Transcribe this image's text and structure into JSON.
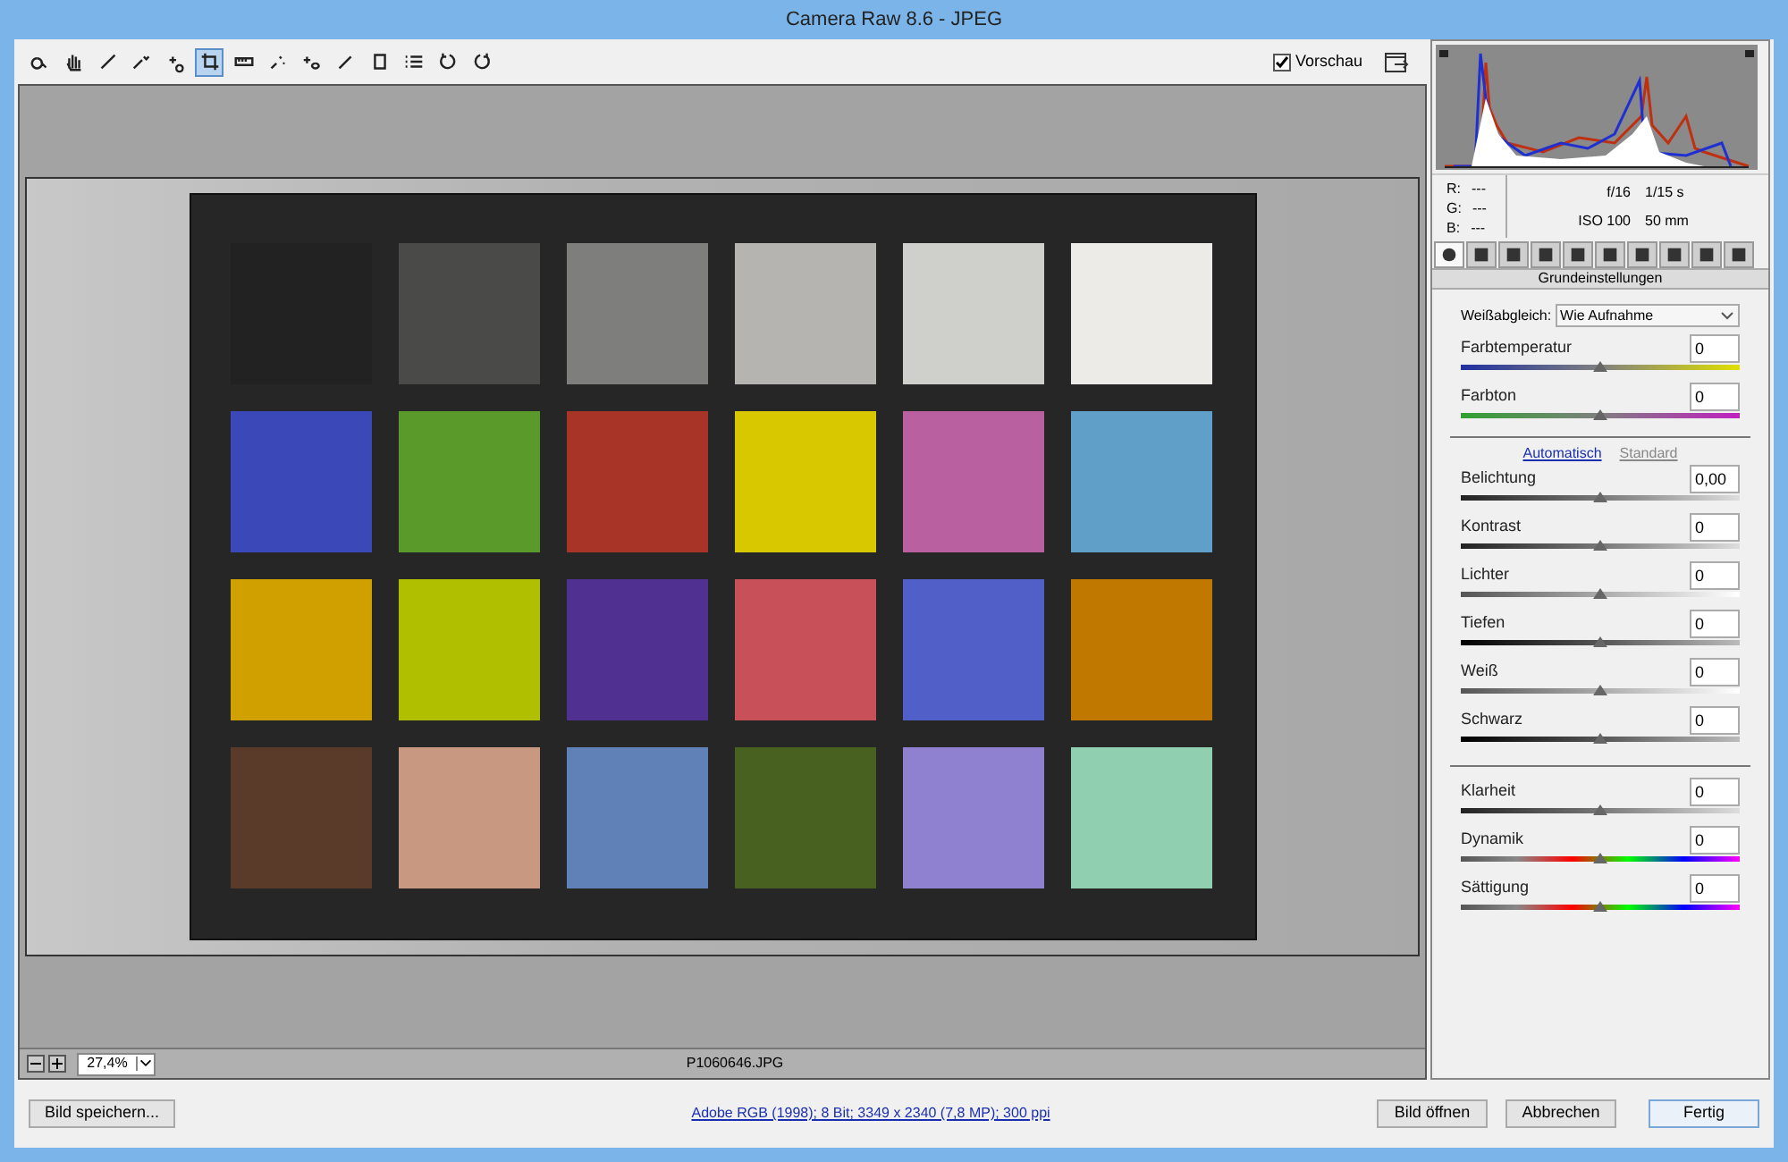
{
  "window": {
    "title": "Camera Raw 8.6 - JPEG"
  },
  "toolbar": {
    "tools": [
      {
        "selected": false
      },
      {
        "selected": false
      },
      {
        "selected": false
      },
      {
        "selected": false
      },
      {
        "selected": false
      },
      {
        "selected": true
      },
      {
        "selected": false
      },
      {
        "selected": false
      },
      {
        "selected": false
      },
      {
        "selected": false
      },
      {
        "selected": false
      },
      {
        "selected": false
      },
      {
        "selected": false
      },
      {
        "selected": false
      }
    ],
    "preview": {
      "label": "Vorschau",
      "checked": true
    }
  },
  "canvas": {
    "zoom": "27,4%",
    "filename": "P1060646.JPG"
  },
  "info": {
    "r_label": "R:",
    "r": "---",
    "g_label": "G:",
    "g": "---",
    "b_label": "B:",
    "b": "---",
    "aperture": "f/16",
    "shutter": "1/15 s",
    "iso": "ISO 100",
    "focal": "50 mm"
  },
  "panel_tabs": [
    {
      "selected": true
    },
    {
      "selected": false
    },
    {
      "selected": false
    },
    {
      "selected": false
    },
    {
      "selected": false
    },
    {
      "selected": false
    },
    {
      "selected": false
    },
    {
      "selected": false
    },
    {
      "selected": false
    },
    {
      "selected": false
    }
  ],
  "panel_title": "Grundeinstellungen",
  "white_balance": {
    "label": "Weißabgleich:",
    "value": "Wie Aufnahme"
  },
  "wb_sliders": [
    {
      "label": "Farbtemperatur",
      "value": "0",
      "level": 0.5,
      "kind": "temperature"
    },
    {
      "label": "Farbton",
      "value": "0",
      "level": 0.5,
      "kind": "tint"
    }
  ],
  "tone_links": {
    "auto": "Automatisch",
    "default": "Standard"
  },
  "tone_sliders": [
    {
      "label": "Belichtung",
      "value": "0,00",
      "level": 0.5,
      "kind": "gray"
    },
    {
      "label": "Kontrast",
      "value": "0",
      "level": 0.5,
      "kind": "gray"
    },
    {
      "label": "Lichter",
      "value": "0",
      "level": 0.5,
      "kind": "light"
    },
    {
      "label": "Tiefen",
      "value": "0",
      "level": 0.5,
      "kind": "dark"
    },
    {
      "label": "Weiß",
      "value": "0",
      "level": 0.5,
      "kind": "light"
    },
    {
      "label": "Schwarz",
      "value": "0",
      "level": 0.5,
      "kind": "dark"
    }
  ],
  "presence_sliders": [
    {
      "label": "Klarheit",
      "value": "0",
      "level": 0.5,
      "kind": "gray"
    },
    {
      "label": "Dynamik",
      "value": "0",
      "level": 0.5,
      "kind": "spectrum"
    },
    {
      "label": "Sättigung",
      "value": "0",
      "level": 0.5,
      "kind": "spectrum"
    }
  ],
  "footer": {
    "save": "Bild speichern...",
    "workflow": "Adobe RGB (1998); 8 Bit; 3349 x 2340 (7,8 MP); 300 ppi",
    "buttons": [
      {
        "label": "Bild öffnen",
        "kind": "plain"
      },
      {
        "label": "Abbrechen",
        "kind": "plain"
      },
      {
        "label": "Fertig",
        "kind": "default"
      }
    ]
  }
}
